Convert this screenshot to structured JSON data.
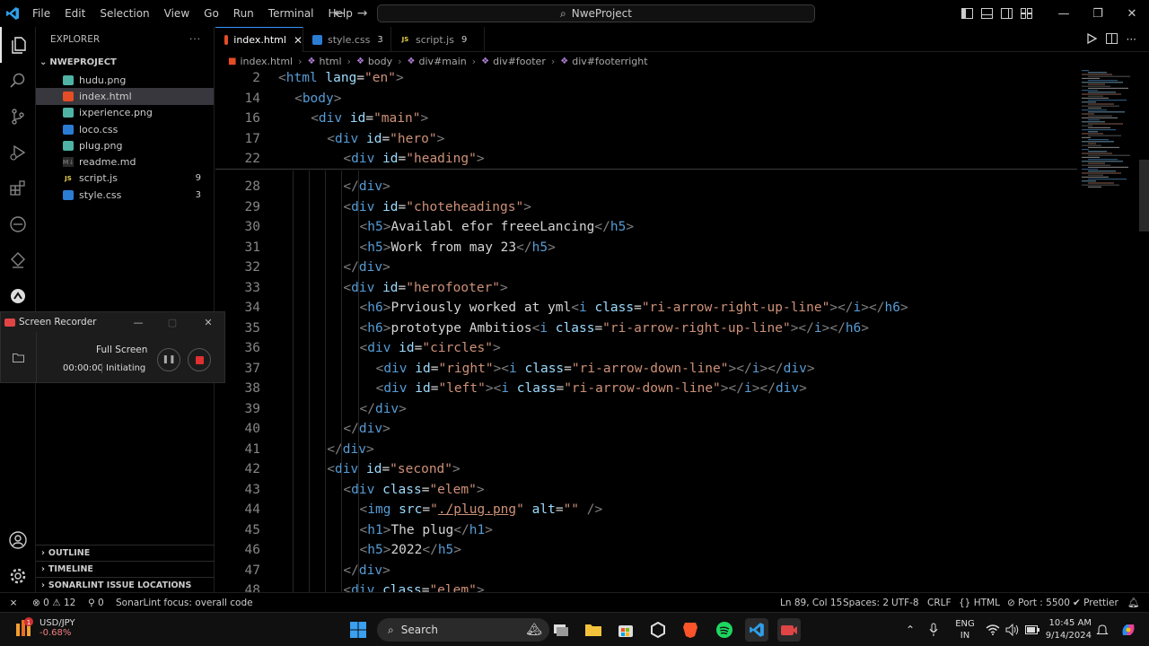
{
  "window": {
    "title": "NweProject",
    "menu": [
      "File",
      "Edit",
      "Selection",
      "View",
      "Go",
      "Run",
      "Terminal",
      "Help"
    ]
  },
  "explorer": {
    "header": "EXPLORER",
    "folder": "NWEPROJECT",
    "files": [
      {
        "name": "hudu.png",
        "type": "png",
        "badge": ""
      },
      {
        "name": "index.html",
        "type": "html",
        "badge": "",
        "selected": true
      },
      {
        "name": "ixperience.png",
        "type": "png",
        "badge": ""
      },
      {
        "name": "loco.css",
        "type": "css",
        "badge": ""
      },
      {
        "name": "plug.png",
        "type": "png",
        "badge": ""
      },
      {
        "name": "readme.md",
        "type": "md",
        "badge": ""
      },
      {
        "name": "script.js",
        "type": "js",
        "badge": "9"
      },
      {
        "name": "style.css",
        "type": "css",
        "badge": "3"
      }
    ],
    "sections": [
      "OUTLINE",
      "TIMELINE",
      "SONARLINT ISSUE LOCATIONS"
    ]
  },
  "recorder": {
    "title": "Screen Recorder",
    "mode": "Full Screen",
    "timer": "00:00:00",
    "status": "Initiating"
  },
  "tabs": [
    {
      "label": "index.html",
      "type": "html",
      "badge": "",
      "active": true
    },
    {
      "label": "style.css",
      "type": "css",
      "badge": "3"
    },
    {
      "label": "script.js",
      "type": "js",
      "badge": "9"
    }
  ],
  "breadcrumb": [
    "index.html",
    "html",
    "body",
    "div#main",
    "div#footer",
    "div#footerright"
  ],
  "code": {
    "sticky": [
      {
        "n": "2",
        "indent": 0,
        "html": "<span class='tag'>&lt;</span><span class='tn'>html</span> <span class='an'>lang</span><span class='tx'>=</span><span class='av'>\"en\"</span><span class='tag'>&gt;</span>"
      },
      {
        "n": "14",
        "indent": 1,
        "html": "<span class='tag'>&lt;</span><span class='tn'>body</span><span class='tag'>&gt;</span>"
      },
      {
        "n": "16",
        "indent": 2,
        "html": "<span class='tag'>&lt;</span><span class='tn'>div</span> <span class='an'>id</span><span class='tx'>=</span><span class='av'>\"main\"</span><span class='tag'>&gt;</span>"
      },
      {
        "n": "17",
        "indent": 3,
        "html": "<span class='tag'>&lt;</span><span class='tn'>div</span> <span class='an'>id</span><span class='tx'>=</span><span class='av'>\"hero\"</span><span class='tag'>&gt;</span>"
      },
      {
        "n": "22",
        "indent": 4,
        "html": "<span class='tag'>&lt;</span><span class='tn'>div</span> <span class='an'>id</span><span class='tx'>=</span><span class='av'>\"heading\"</span><span class='tag'>&gt;</span>"
      }
    ],
    "lines": [
      {
        "n": "28",
        "indent": 4,
        "html": "<span class='tag'>&lt;/</span><span class='tn'>div</span><span class='tag'>&gt;</span>"
      },
      {
        "n": "29",
        "indent": 4,
        "html": "<span class='tag'>&lt;</span><span class='tn'>div</span> <span class='an'>id</span><span class='tx'>=</span><span class='av'>\"choteheadings\"</span><span class='tag'>&gt;</span>"
      },
      {
        "n": "30",
        "indent": 5,
        "html": "<span class='tag'>&lt;</span><span class='tn'>h5</span><span class='tag'>&gt;</span><span class='tx'>Availabl efor freeeLancing</span><span class='tag'>&lt;/</span><span class='tn'>h5</span><span class='tag'>&gt;</span>"
      },
      {
        "n": "31",
        "indent": 5,
        "html": "<span class='tag'>&lt;</span><span class='tn'>h5</span><span class='tag'>&gt;</span><span class='tx'>Work from may 23</span><span class='tag'>&lt;/</span><span class='tn'>h5</span><span class='tag'>&gt;</span>"
      },
      {
        "n": "32",
        "indent": 4,
        "html": "<span class='tag'>&lt;/</span><span class='tn'>div</span><span class='tag'>&gt;</span>"
      },
      {
        "n": "33",
        "indent": 4,
        "html": "<span class='tag'>&lt;</span><span class='tn'>div</span> <span class='an'>id</span><span class='tx'>=</span><span class='av'>\"herofooter\"</span><span class='tag'>&gt;</span>"
      },
      {
        "n": "34",
        "indent": 5,
        "html": "<span class='tag'>&lt;</span><span class='tn'>h6</span><span class='tag'>&gt;</span><span class='tx'>Prviously worked at yml</span><span class='tag'>&lt;</span><span class='tn'>i</span> <span class='an'>class</span><span class='tx'>=</span><span class='av'>\"ri-arrow-right-up-line\"</span><span class='tag'>&gt;&lt;/</span><span class='tn'>i</span><span class='tag'>&gt;&lt;/</span><span class='tn'>h6</span><span class='tag'>&gt;</span>"
      },
      {
        "n": "35",
        "indent": 5,
        "html": "<span class='tag'>&lt;</span><span class='tn'>h6</span><span class='tag'>&gt;</span><span class='tx'>prototype Ambitios</span><span class='tag'>&lt;</span><span class='tn'>i</span> <span class='an'>class</span><span class='tx'>=</span><span class='av'>\"ri-arrow-right-up-line\"</span><span class='tag'>&gt;&lt;/</span><span class='tn'>i</span><span class='tag'>&gt;&lt;/</span><span class='tn'>h6</span><span class='tag'>&gt;</span>"
      },
      {
        "n": "36",
        "indent": 5,
        "html": "<span class='tag'>&lt;</span><span class='tn'>div</span> <span class='an'>id</span><span class='tx'>=</span><span class='av'>\"circles\"</span><span class='tag'>&gt;</span>"
      },
      {
        "n": "37",
        "indent": 6,
        "html": "<span class='tag'>&lt;</span><span class='tn'>div</span> <span class='an'>id</span><span class='tx'>=</span><span class='av'>\"right\"</span><span class='tag'>&gt;&lt;</span><span class='tn'>i</span> <span class='an'>class</span><span class='tx'>=</span><span class='av'>\"ri-arrow-down-line\"</span><span class='tag'>&gt;&lt;/</span><span class='tn'>i</span><span class='tag'>&gt;&lt;/</span><span class='tn'>div</span><span class='tag'>&gt;</span>"
      },
      {
        "n": "38",
        "indent": 6,
        "html": "<span class='tag'>&lt;</span><span class='tn'>div</span> <span class='an'>id</span><span class='tx'>=</span><span class='av'>\"left\"</span><span class='tag'>&gt;&lt;</span><span class='tn'>i</span> <span class='an'>class</span><span class='tx'>=</span><span class='av'>\"ri-arrow-down-line\"</span><span class='tag'>&gt;&lt;/</span><span class='tn'>i</span><span class='tag'>&gt;&lt;/</span><span class='tn'>div</span><span class='tag'>&gt;</span>"
      },
      {
        "n": "39",
        "indent": 5,
        "html": "<span class='tag'>&lt;/</span><span class='tn'>div</span><span class='tag'>&gt;</span>"
      },
      {
        "n": "40",
        "indent": 4,
        "html": "<span class='tag'>&lt;/</span><span class='tn'>div</span><span class='tag'>&gt;</span>"
      },
      {
        "n": "41",
        "indent": 3,
        "html": "<span class='tag'>&lt;/</span><span class='tn'>div</span><span class='tag'>&gt;</span>"
      },
      {
        "n": "42",
        "indent": 3,
        "html": "<span class='tag'>&lt;</span><span class='tn'>div</span> <span class='an'>id</span><span class='tx'>=</span><span class='av'>\"second\"</span><span class='tag'>&gt;</span>"
      },
      {
        "n": "43",
        "indent": 4,
        "html": "<span class='tag'>&lt;</span><span class='tn'>div</span> <span class='an'>class</span><span class='tx'>=</span><span class='av'>\"elem\"</span><span class='tag'>&gt;</span>"
      },
      {
        "n": "44",
        "indent": 5,
        "html": "<span class='tag'>&lt;</span><span class='tn'>img</span> <span class='an'>src</span><span class='tx'>=</span><span class='av'>\"<span class='ul'>./plug.png</span>\"</span> <span class='an'>alt</span><span class='tx'>=</span><span class='av'>\"\"</span> <span class='tag'>/&gt;</span>"
      },
      {
        "n": "45",
        "indent": 5,
        "html": "<span class='tag'>&lt;</span><span class='tn'>h1</span><span class='tag'>&gt;</span><span class='tx'>The plug</span><span class='tag'>&lt;/</span><span class='tn'>h1</span><span class='tag'>&gt;</span>"
      },
      {
        "n": "46",
        "indent": 5,
        "html": "<span class='tag'>&lt;</span><span class='tn'>h5</span><span class='tag'>&gt;</span><span class='tx'>2022</span><span class='tag'>&lt;/</span><span class='tn'>h5</span><span class='tag'>&gt;</span>"
      },
      {
        "n": "47",
        "indent": 4,
        "html": "<span class='tag'>&lt;/</span><span class='tn'>div</span><span class='tag'>&gt;</span>"
      },
      {
        "n": "48",
        "indent": 4,
        "html": "<span class='tag'>&lt;</span><span class='tn'>div</span> <span class='an'>class</span><span class='tx'>=</span><span class='av'>\"elem\"</span><span class='tag'>&gt;</span>"
      }
    ]
  },
  "status": {
    "errors": "0",
    "warnings": "12",
    "info": "0",
    "sonarlint": "SonarLint focus: overall code",
    "position": "Ln 89, Col 15",
    "spaces": "Spaces: 2",
    "encoding": "UTF-8",
    "eol": "CRLF",
    "language": "HTML",
    "port": "Port : 5500",
    "prettier": "Prettier"
  },
  "taskbar": {
    "ticker": "USD/JPY",
    "change": "-0.68%",
    "search": "Search",
    "lang1": "ENG",
    "lang2": "IN",
    "time": "10:45 AM",
    "date": "9/14/2024",
    "notif_badge": "1"
  }
}
